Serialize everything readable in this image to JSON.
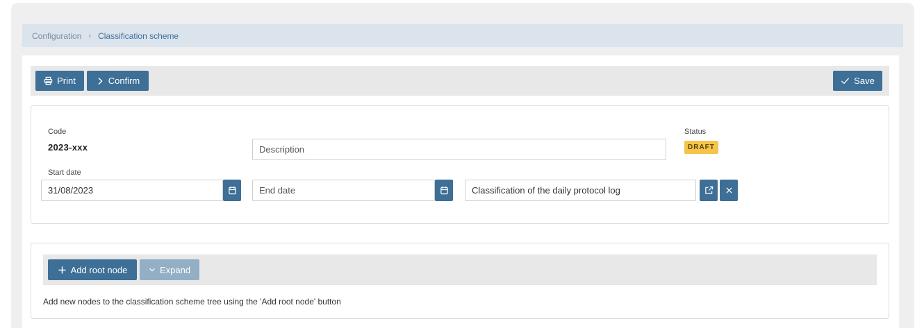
{
  "breadcrumb": {
    "parent": "Configuration",
    "separator": "›",
    "current": "Classification scheme"
  },
  "toolbar": {
    "print_label": "Print",
    "confirm_label": "Confirm",
    "save_label": "Save"
  },
  "form": {
    "code_label": "Code",
    "code_value": "2023-xxx",
    "description_placeholder": "Description",
    "status_label": "Status",
    "status_value": "DRAFT",
    "start_date_label": "Start date",
    "start_date_value": "31/08/2023",
    "end_date_placeholder": "End date",
    "classification_value": "Classification of the daily protocol log"
  },
  "tree": {
    "add_root_label": "Add root node",
    "expand_label": "Expand",
    "hint": "Add new nodes to the classification scheme tree using the 'Add root node' button"
  },
  "colors": {
    "primary": "#3d6f97",
    "status_draft": "#f5c44c",
    "breadcrumb_bg": "#dbe3ed"
  },
  "icons": [
    "printer-icon",
    "chevron-right-icon",
    "check-icon",
    "calendar-icon",
    "external-link-icon",
    "close-icon",
    "plus-icon",
    "chevron-down-icon"
  ]
}
